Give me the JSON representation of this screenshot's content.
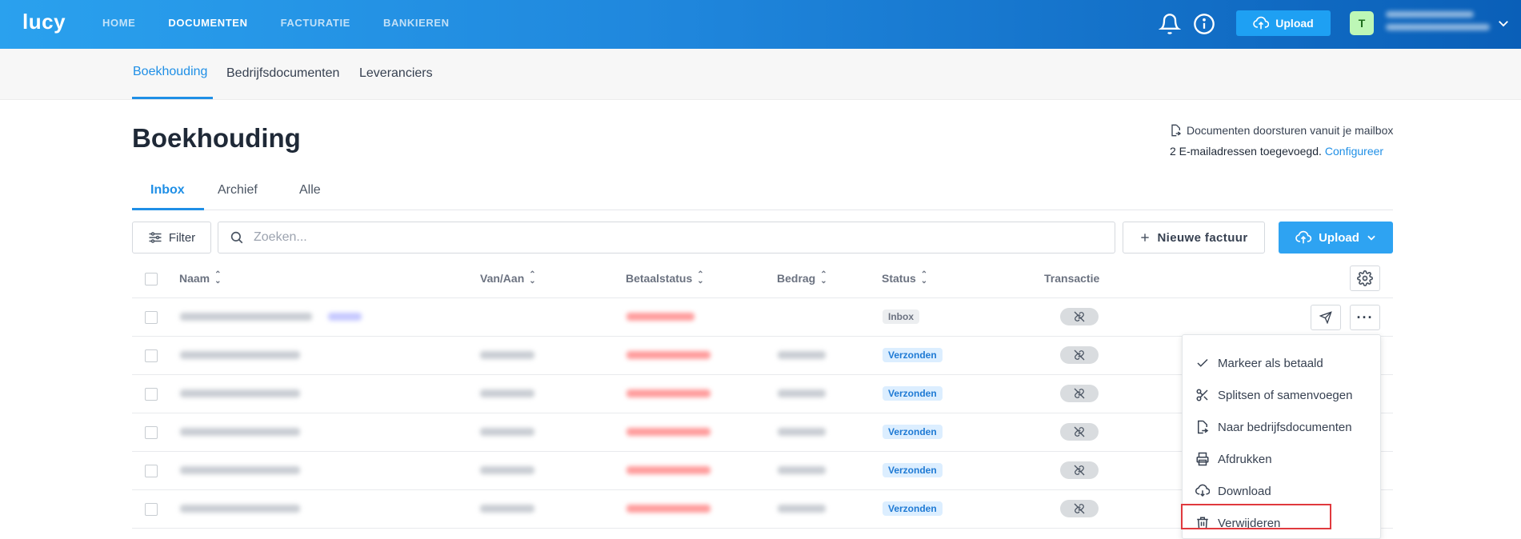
{
  "app": {
    "logo": "lucy",
    "user_initial": "T"
  },
  "nav": {
    "items": [
      "HOME",
      "DOCUMENTEN",
      "FACTURATIE",
      "BANKIEREN"
    ],
    "active": "DOCUMENTEN"
  },
  "topbar": {
    "upload_label": "Upload",
    "icons": [
      "bell-icon",
      "info-icon",
      "cloud-upload-icon",
      "chevron-down-icon"
    ]
  },
  "subnav": {
    "tabs": [
      "Boekhouding",
      "Bedrijfsdocumenten",
      "Leveranciers"
    ],
    "active": "Boekhouding"
  },
  "page": {
    "title": "Boekhouding",
    "mail_forward": "Documenten doorsturen vanuit je mailbox",
    "mail_count": "2 E-mailadressen toegevoegd.",
    "configure_link": "Configureer"
  },
  "tabs": {
    "items": [
      "Inbox",
      "Archief",
      "Alle"
    ],
    "active": "Inbox"
  },
  "toolbar": {
    "filter_label": "Filter",
    "search_placeholder": "Zoeken...",
    "new_invoice_label": "Nieuwe factuur",
    "upload_label": "Upload"
  },
  "table": {
    "columns": [
      "Naam",
      "Van/Aan",
      "Betaalstatus",
      "Bedrag",
      "Status",
      "Transactie"
    ],
    "rows": [
      {
        "status": "Inbox"
      },
      {
        "status": "Verzonden"
      },
      {
        "status": "Verzonden"
      },
      {
        "status": "Verzonden"
      },
      {
        "status": "Verzonden"
      },
      {
        "status": "Verzonden"
      }
    ]
  },
  "menu": {
    "items": [
      {
        "label": "Markeer als betaald",
        "icon": "check-icon"
      },
      {
        "label": "Splitsen of samenvoegen",
        "icon": "scissors-icon"
      },
      {
        "label": "Naar bedrijfsdocumenten",
        "icon": "file-move-icon"
      },
      {
        "label": "Afdrukken",
        "icon": "printer-icon"
      },
      {
        "label": "Download",
        "icon": "download-icon"
      },
      {
        "label": "Verwijderen",
        "icon": "trash-icon"
      }
    ],
    "highlighted": "Verwijderen"
  },
  "colors": {
    "accent": "#1f8fe6",
    "topbar_start": "#2aa1ee",
    "topbar_end": "#0a5fb8",
    "highlight": "#e0393e",
    "sent_badge": "#dceeff"
  }
}
